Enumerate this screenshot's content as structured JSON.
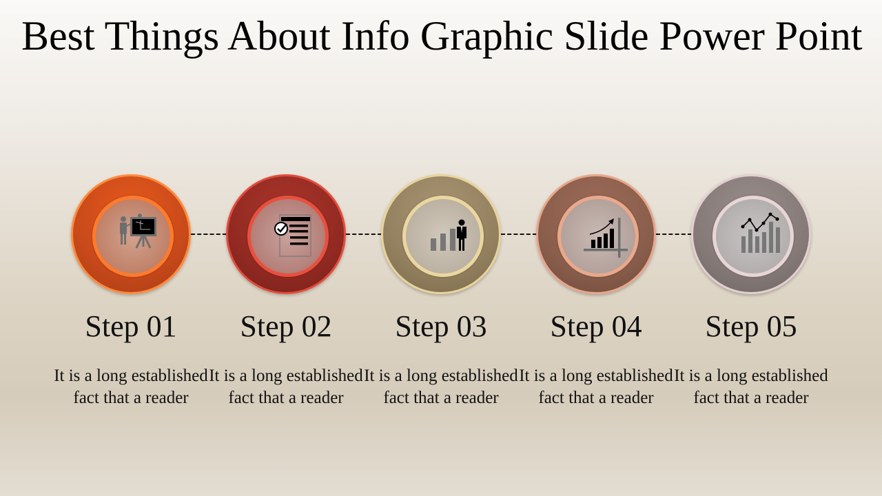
{
  "slide": {
    "title": " Best Things About Info Graphic Slide Power Point"
  },
  "steps": [
    {
      "label": "Step 01",
      "description": "It is a long established fact that a reader",
      "icon": "presentation-board-icon",
      "color": "#d4511c"
    },
    {
      "label": "Step 02",
      "description": "It is a long established fact that a reader",
      "icon": "checklist-document-icon",
      "color": "#9a2e25"
    },
    {
      "label": "Step 03",
      "description": "It is a long established fact that a reader",
      "icon": "businessman-growth-bars-icon",
      "color": "#9a8664"
    },
    {
      "label": "Step 04",
      "description": "It is a long established fact that a reader",
      "icon": "rising-bar-chart-icon",
      "color": "#8d604e"
    },
    {
      "label": "Step 05",
      "description": "It is a long established fact that a reader",
      "icon": "line-bar-chart-icon",
      "color": "#877d7b"
    }
  ]
}
